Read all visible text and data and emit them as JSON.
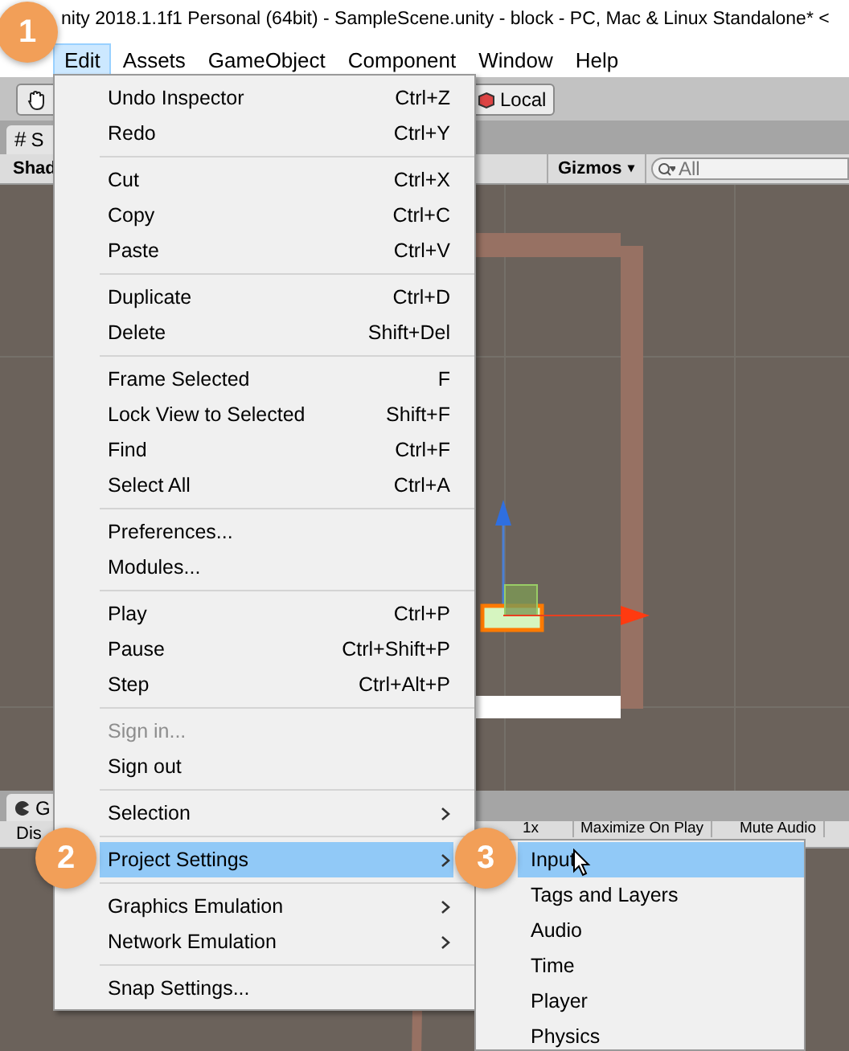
{
  "window": {
    "title": "nity 2018.1.1f1 Personal (64bit) - SampleScene.unity - block - PC, Mac & Linux Standalone* <"
  },
  "menu_bar": [
    {
      "label": "Edit",
      "selected": true
    },
    {
      "label": "Assets",
      "selected": false
    },
    {
      "label": "GameObject",
      "selected": false
    },
    {
      "label": "Component",
      "selected": false
    },
    {
      "label": "Window",
      "selected": false
    },
    {
      "label": "Help",
      "selected": false
    }
  ],
  "toolbar": {
    "pivot_button": "Local"
  },
  "scene_tab": {
    "icon": "#",
    "label": "S"
  },
  "scene_toolbar": {
    "shading": "Shad",
    "gizmos": "Gizmos",
    "gizmos_caret": "▾",
    "search": {
      "placeholder": "All"
    }
  },
  "game_tab": {
    "label": "G"
  },
  "game_toolbar": {
    "display": "Dis",
    "scale": "1x",
    "maximize": "Maximize On Play",
    "mute": "Mute Audio"
  },
  "edit_menu": [
    {
      "kind": "item",
      "label": "Undo Inspector",
      "shortcut": "Ctrl+Z",
      "disabled": false,
      "selected": false,
      "submenu": false
    },
    {
      "kind": "item",
      "label": "Redo",
      "shortcut": "Ctrl+Y",
      "disabled": false,
      "selected": false,
      "submenu": false
    },
    {
      "kind": "separator"
    },
    {
      "kind": "item",
      "label": "Cut",
      "shortcut": "Ctrl+X",
      "disabled": false,
      "selected": false,
      "submenu": false
    },
    {
      "kind": "item",
      "label": "Copy",
      "shortcut": "Ctrl+C",
      "disabled": false,
      "selected": false,
      "submenu": false
    },
    {
      "kind": "item",
      "label": "Paste",
      "shortcut": "Ctrl+V",
      "disabled": false,
      "selected": false,
      "submenu": false
    },
    {
      "kind": "separator"
    },
    {
      "kind": "item",
      "label": "Duplicate",
      "shortcut": "Ctrl+D",
      "disabled": false,
      "selected": false,
      "submenu": false
    },
    {
      "kind": "item",
      "label": "Delete",
      "shortcut": "Shift+Del",
      "disabled": false,
      "selected": false,
      "submenu": false
    },
    {
      "kind": "separator"
    },
    {
      "kind": "item",
      "label": "Frame Selected",
      "shortcut": "F",
      "disabled": false,
      "selected": false,
      "submenu": false
    },
    {
      "kind": "item",
      "label": "Lock View to Selected",
      "shortcut": "Shift+F",
      "disabled": false,
      "selected": false,
      "submenu": false
    },
    {
      "kind": "item",
      "label": "Find",
      "shortcut": "Ctrl+F",
      "disabled": false,
      "selected": false,
      "submenu": false
    },
    {
      "kind": "item",
      "label": "Select All",
      "shortcut": "Ctrl+A",
      "disabled": false,
      "selected": false,
      "submenu": false
    },
    {
      "kind": "separator"
    },
    {
      "kind": "item",
      "label": "Preferences...",
      "disabled": false,
      "selected": false,
      "submenu": false
    },
    {
      "kind": "item",
      "label": "Modules...",
      "disabled": false,
      "selected": false,
      "submenu": false
    },
    {
      "kind": "separator"
    },
    {
      "kind": "item",
      "label": "Play",
      "shortcut": "Ctrl+P",
      "disabled": false,
      "selected": false,
      "submenu": false
    },
    {
      "kind": "item",
      "label": "Pause",
      "shortcut": "Ctrl+Shift+P",
      "disabled": false,
      "selected": false,
      "submenu": false
    },
    {
      "kind": "item",
      "label": "Step",
      "shortcut": "Ctrl+Alt+P",
      "disabled": false,
      "selected": false,
      "submenu": false
    },
    {
      "kind": "separator"
    },
    {
      "kind": "item",
      "label": "Sign in...",
      "disabled": true,
      "selected": false,
      "submenu": false
    },
    {
      "kind": "item",
      "label": "Sign out",
      "disabled": false,
      "selected": false,
      "submenu": false
    },
    {
      "kind": "separator"
    },
    {
      "kind": "item",
      "label": "Selection",
      "disabled": false,
      "selected": false,
      "submenu": true
    },
    {
      "kind": "separator"
    },
    {
      "kind": "item",
      "label": "Project Settings",
      "disabled": false,
      "selected": true,
      "submenu": true
    },
    {
      "kind": "separator"
    },
    {
      "kind": "item",
      "label": "Graphics Emulation",
      "disabled": false,
      "selected": false,
      "submenu": true
    },
    {
      "kind": "item",
      "label": "Network Emulation",
      "disabled": false,
      "selected": false,
      "submenu": true
    },
    {
      "kind": "separator"
    },
    {
      "kind": "item",
      "label": "Snap Settings...",
      "disabled": false,
      "selected": false,
      "submenu": false
    }
  ],
  "project_settings_menu": [
    {
      "label": "Input",
      "selected": true
    },
    {
      "label": "Tags and Layers",
      "selected": false
    },
    {
      "label": "Audio",
      "selected": false
    },
    {
      "label": "Time",
      "selected": false
    },
    {
      "label": "Player",
      "selected": false
    },
    {
      "label": "Physics",
      "selected": false
    }
  ],
  "step_badges": [
    {
      "label": "1"
    },
    {
      "label": "2"
    },
    {
      "label": "3"
    }
  ]
}
